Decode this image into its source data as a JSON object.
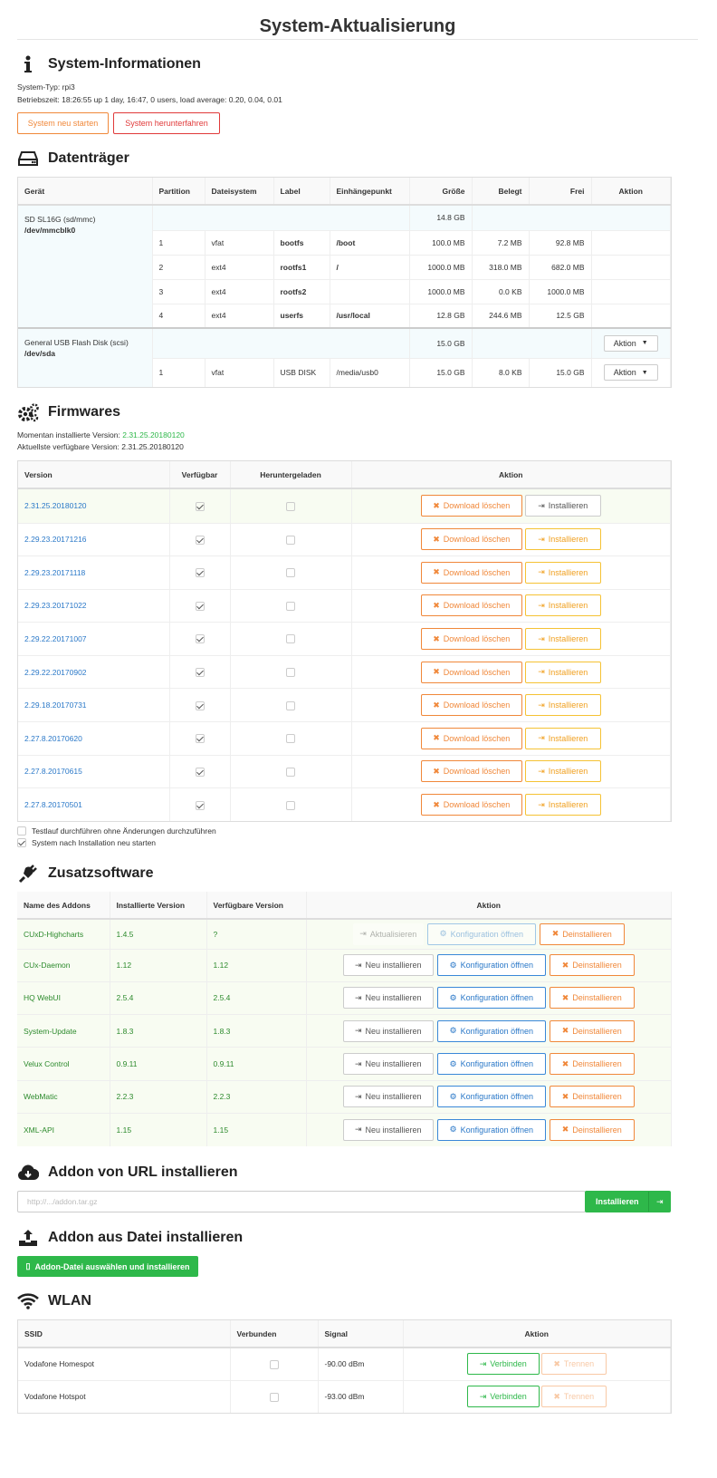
{
  "page_title": "System-Aktualisierung",
  "sysinfo": {
    "heading": "System-Informationen",
    "type": "System-Typ: rpi3",
    "uptime": "Betriebszeit: 18:26:55 up 1 day, 16:47, 0 users, load average: 0.20, 0.04, 0.01",
    "btn_restart": "System neu starten",
    "btn_shutdown": "System herunterfahren"
  },
  "disks": {
    "heading": "Datenträger",
    "headers": [
      "Gerät",
      "Partition",
      "Dateisystem",
      "Label",
      "Einhängepunkt",
      "Größe",
      "Belegt",
      "Frei",
      "Aktion"
    ],
    "devices": [
      {
        "name": "SD SL16G (sd/mmc)",
        "path": "/dev/mmcblk0",
        "size": "14.8 GB",
        "partitions": [
          [
            "1",
            "vfat",
            "bootfs",
            "/boot",
            "100.0 MB",
            "7.2 MB",
            "92.8 MB"
          ],
          [
            "2",
            "ext4",
            "rootfs1",
            "/",
            "1000.0 MB",
            "318.0 MB",
            "682.0 MB"
          ],
          [
            "3",
            "ext4",
            "rootfs2",
            "",
            "1000.0 MB",
            "0.0 KB",
            "1000.0 MB"
          ],
          [
            "4",
            "ext4",
            "userfs",
            "/usr/local",
            "12.8 GB",
            "244.6 MB",
            "12.5 GB"
          ]
        ]
      },
      {
        "name": "General USB Flash Disk (scsi)",
        "path": "/dev/sda",
        "size": "15.0 GB",
        "action": "Aktion",
        "partitions": [
          [
            "1",
            "vfat",
            "USB DISK",
            "/media/usb0",
            "15.0 GB",
            "8.0 KB",
            "15.0 GB"
          ]
        ]
      }
    ],
    "action_label": "Aktion"
  },
  "firmware": {
    "heading": "Firmwares",
    "installed_label": "Momentan installierte Version: ",
    "installed": "2.31.25.20180120",
    "latest": "Aktuellste verfügbare Version: 2.31.25.20180120",
    "headers": [
      "Version",
      "Verfügbar",
      "Heruntergeladen",
      "Aktion"
    ],
    "versions": [
      "2.31.25.20180120",
      "2.29.23.20171216",
      "2.29.23.20171118",
      "2.29.23.20171022",
      "2.29.22.20171007",
      "2.29.22.20170902",
      "2.29.18.20170731",
      "2.27.8.20170620",
      "2.27.8.20170615",
      "2.27.8.20170501"
    ],
    "btn_delete": "Download löschen",
    "btn_install": "Installieren",
    "opt_dryrun": "Testlauf durchführen ohne Änderungen durchzuführen",
    "opt_reboot": "System nach Installation neu starten"
  },
  "addons": {
    "heading": "Zusatzsoftware",
    "headers": [
      "Name des Addons",
      "Installierte Version",
      "Verfügbare Version",
      "Aktion"
    ],
    "rows": [
      [
        "CUxD-Highcharts",
        "1.4.5",
        "?"
      ],
      [
        "CUx-Daemon",
        "1.12",
        "1.12"
      ],
      [
        "HQ WebUI",
        "2.5.4",
        "2.5.4"
      ],
      [
        "System-Update",
        "1.8.3",
        "1.8.3"
      ],
      [
        "Velux Control",
        "0.9.11",
        "0.9.11"
      ],
      [
        "WebMatic",
        "2.2.3",
        "2.2.3"
      ],
      [
        "XML-API",
        "1.15",
        "1.15"
      ]
    ],
    "btn_update": "Aktualisieren",
    "btn_reinstall": "Neu installieren",
    "btn_config": "Konfiguration öffnen",
    "btn_uninstall": "Deinstallieren"
  },
  "url_install": {
    "heading": "Addon von URL installieren",
    "placeholder": "http://.../addon.tar.gz",
    "btn": "Installieren"
  },
  "file_install": {
    "heading": "Addon aus Datei installieren",
    "btn": "Addon-Datei auswählen und installieren"
  },
  "wlan": {
    "heading": "WLAN",
    "headers": [
      "SSID",
      "Verbunden",
      "Signal",
      "Aktion"
    ],
    "rows": [
      [
        "Vodafone Homespot",
        "-90.00 dBm"
      ],
      [
        "Vodafone Hotspot",
        "-93.00 dBm"
      ]
    ],
    "btn_connect": "Verbinden",
    "btn_disconnect": "Trennen"
  }
}
